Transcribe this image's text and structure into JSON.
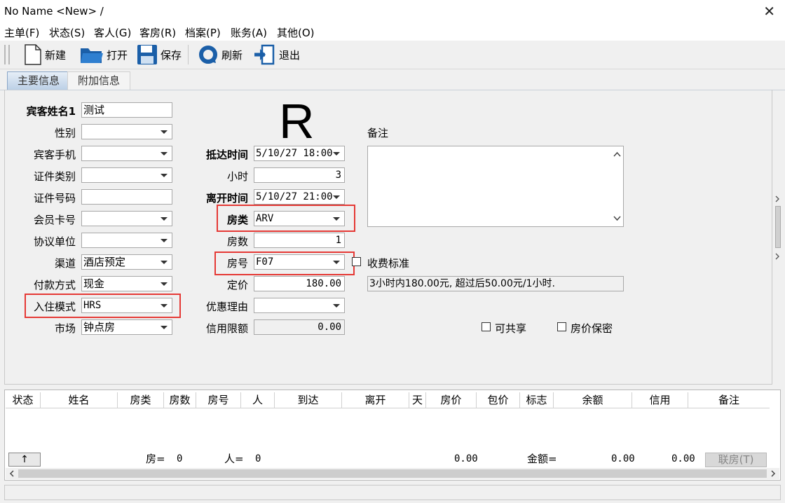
{
  "window": {
    "title": "No Name <New> /",
    "close_glyph": "✕"
  },
  "menu": [
    "主单(F)",
    "状态(S)",
    "客人(G)",
    "客房(R)",
    "档案(P)",
    "账务(A)",
    "其他(O)"
  ],
  "toolbar": {
    "new_label": "新建",
    "open_label": "打开",
    "save_label": "保存",
    "refresh_label": "刷新",
    "exit_label": "退出"
  },
  "tabs": {
    "main": "主要信息",
    "extra": "附加信息"
  },
  "form": {
    "guest_name_label": "宾客姓名1",
    "guest_name_value": "测试",
    "gender_label": "性别",
    "gender_value": "",
    "mobile_label": "宾客手机",
    "mobile_value": "",
    "id_type_label": "证件类别",
    "id_type_value": "",
    "id_no_label": "证件号码",
    "id_no_value": "",
    "member_label": "会员卡号",
    "member_value": "",
    "agreement_label": "协议单位",
    "agreement_value": "",
    "channel_label": "渠道",
    "channel_value": "酒店预定",
    "payment_label": "付款方式",
    "payment_value": "现金",
    "checkin_mode_label": "入住模式",
    "checkin_mode_value": "HRS",
    "market_label": "市场",
    "market_value": "钟点房",
    "status_code": "R",
    "arrival_label": "抵达时间",
    "arrival_value": "5/10/27 18:00",
    "hours_label": "小时",
    "hours_value": "3",
    "departure_label": "离开时间",
    "departure_value": "5/10/27 21:00",
    "room_type_label": "房类",
    "room_type_value": "ARV",
    "room_count_label": "房数",
    "room_count_value": "1",
    "room_no_label": "房号",
    "room_no_value": "F07",
    "price_label": "定价",
    "price_value": "180.00",
    "discount_label": "优惠理由",
    "discount_value": "",
    "credit_label": "信用限额",
    "credit_value": "0.00",
    "remarks_label": "备注",
    "charge_std_label": "收费标准",
    "charge_std_text": "3小时内180.00元, 超过后50.00元/1小时.",
    "shareable_label": "可共享",
    "price_secret_label": "房价保密"
  },
  "grid": {
    "columns": [
      "状态",
      "姓名",
      "房类",
      "房数",
      "房号",
      "人",
      "到达",
      "离开",
      "天",
      "房价",
      "包价",
      "标志",
      "余额",
      "信用",
      "备注"
    ],
    "up_button": "↑",
    "footer": {
      "rooms_label": "房=",
      "rooms_value": "0",
      "people_label": "人=",
      "people_value": "0",
      "price_total": "0.00",
      "amount_label": "金额=",
      "amount_value": "0.00",
      "credit_total": "0.00",
      "link_room_button": "联房(T)"
    }
  }
}
